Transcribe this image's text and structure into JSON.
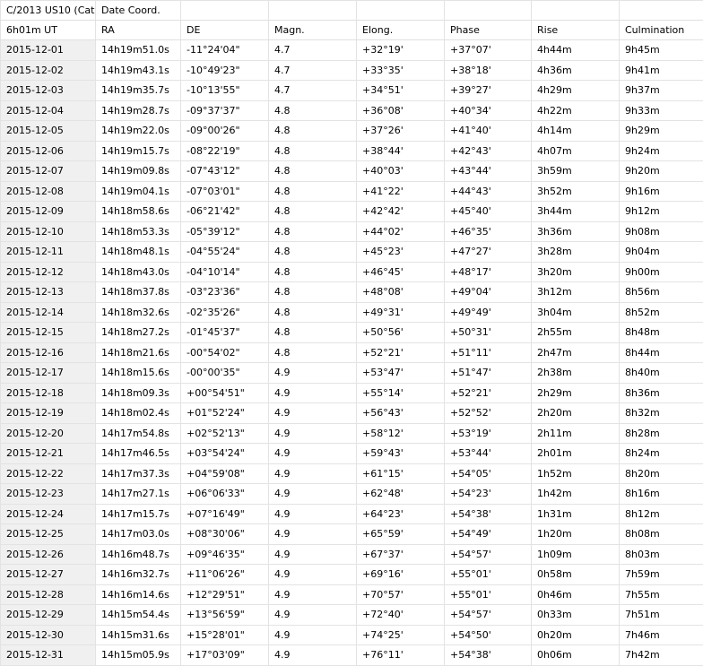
{
  "title_row": [
    "C/2013 US10 (Cata",
    "Date Coord.",
    "",
    "",
    "",
    "",
    "",
    ""
  ],
  "columns": [
    "6h01m UT",
    "RA",
    "DE",
    "Magn.",
    "Elong.",
    "Phase",
    "Rise",
    "Culmination"
  ],
  "rows": [
    [
      "2015-12-01",
      "14h19m51.0s",
      "-11°24'04\"",
      "4.7",
      "+32°19'",
      "+37°07'",
      "4h44m",
      "9h45m"
    ],
    [
      "2015-12-02",
      "14h19m43.1s",
      "-10°49'23\"",
      "4.7",
      "+33°35'",
      "+38°18'",
      "4h36m",
      "9h41m"
    ],
    [
      "2015-12-03",
      "14h19m35.7s",
      "-10°13'55\"",
      "4.7",
      "+34°51'",
      "+39°27'",
      "4h29m",
      "9h37m"
    ],
    [
      "2015-12-04",
      "14h19m28.7s",
      "-09°37'37\"",
      "4.8",
      "+36°08'",
      "+40°34'",
      "4h22m",
      "9h33m"
    ],
    [
      "2015-12-05",
      "14h19m22.0s",
      "-09°00'26\"",
      "4.8",
      "+37°26'",
      "+41°40'",
      "4h14m",
      "9h29m"
    ],
    [
      "2015-12-06",
      "14h19m15.7s",
      "-08°22'19\"",
      "4.8",
      "+38°44'",
      "+42°43'",
      "4h07m",
      "9h24m"
    ],
    [
      "2015-12-07",
      "14h19m09.8s",
      "-07°43'12\"",
      "4.8",
      "+40°03'",
      "+43°44'",
      "3h59m",
      "9h20m"
    ],
    [
      "2015-12-08",
      "14h19m04.1s",
      "-07°03'01\"",
      "4.8",
      "+41°22'",
      "+44°43'",
      "3h52m",
      "9h16m"
    ],
    [
      "2015-12-09",
      "14h18m58.6s",
      "-06°21'42\"",
      "4.8",
      "+42°42'",
      "+45°40'",
      "3h44m",
      "9h12m"
    ],
    [
      "2015-12-10",
      "14h18m53.3s",
      "-05°39'12\"",
      "4.8",
      "+44°02'",
      "+46°35'",
      "3h36m",
      "9h08m"
    ],
    [
      "2015-12-11",
      "14h18m48.1s",
      "-04°55'24\"",
      "4.8",
      "+45°23'",
      "+47°27'",
      "3h28m",
      "9h04m"
    ],
    [
      "2015-12-12",
      "14h18m43.0s",
      "-04°10'14\"",
      "4.8",
      "+46°45'",
      "+48°17'",
      "3h20m",
      "9h00m"
    ],
    [
      "2015-12-13",
      "14h18m37.8s",
      "-03°23'36\"",
      "4.8",
      "+48°08'",
      "+49°04'",
      "3h12m",
      "8h56m"
    ],
    [
      "2015-12-14",
      "14h18m32.6s",
      "-02°35'26\"",
      "4.8",
      "+49°31'",
      "+49°49'",
      "3h04m",
      "8h52m"
    ],
    [
      "2015-12-15",
      "14h18m27.2s",
      "-01°45'37\"",
      "4.8",
      "+50°56'",
      "+50°31'",
      "2h55m",
      "8h48m"
    ],
    [
      "2015-12-16",
      "14h18m21.6s",
      "-00°54'02\"",
      "4.8",
      "+52°21'",
      "+51°11'",
      "2h47m",
      "8h44m"
    ],
    [
      "2015-12-17",
      "14h18m15.6s",
      "-00°00'35\"",
      "4.9",
      "+53°47'",
      "+51°47'",
      "2h38m",
      "8h40m"
    ],
    [
      "2015-12-18",
      "14h18m09.3s",
      "+00°54'51\"",
      "4.9",
      "+55°14'",
      "+52°21'",
      "2h29m",
      "8h36m"
    ],
    [
      "2015-12-19",
      "14h18m02.4s",
      "+01°52'24\"",
      "4.9",
      "+56°43'",
      "+52°52'",
      "2h20m",
      "8h32m"
    ],
    [
      "2015-12-20",
      "14h17m54.8s",
      "+02°52'13\"",
      "4.9",
      "+58°12'",
      "+53°19'",
      "2h11m",
      "8h28m"
    ],
    [
      "2015-12-21",
      "14h17m46.5s",
      "+03°54'24\"",
      "4.9",
      "+59°43'",
      "+53°44'",
      "2h01m",
      "8h24m"
    ],
    [
      "2015-12-22",
      "14h17m37.3s",
      "+04°59'08\"",
      "4.9",
      "+61°15'",
      "+54°05'",
      "1h52m",
      "8h20m"
    ],
    [
      "2015-12-23",
      "14h17m27.1s",
      "+06°06'33\"",
      "4.9",
      "+62°48'",
      "+54°23'",
      "1h42m",
      "8h16m"
    ],
    [
      "2015-12-24",
      "14h17m15.7s",
      "+07°16'49\"",
      "4.9",
      "+64°23'",
      "+54°38'",
      "1h31m",
      "8h12m"
    ],
    [
      "2015-12-25",
      "14h17m03.0s",
      "+08°30'06\"",
      "4.9",
      "+65°59'",
      "+54°49'",
      "1h20m",
      "8h08m"
    ],
    [
      "2015-12-26",
      "14h16m48.7s",
      "+09°46'35\"",
      "4.9",
      "+67°37'",
      "+54°57'",
      "1h09m",
      "8h03m"
    ],
    [
      "2015-12-27",
      "14h16m32.7s",
      "+11°06'26\"",
      "4.9",
      "+69°16'",
      "+55°01'",
      "0h58m",
      "7h59m"
    ],
    [
      "2015-12-28",
      "14h16m14.6s",
      "+12°29'51\"",
      "4.9",
      "+70°57'",
      "+55°01'",
      "0h46m",
      "7h55m"
    ],
    [
      "2015-12-29",
      "14h15m54.4s",
      "+13°56'59\"",
      "4.9",
      "+72°40'",
      "+54°57'",
      "0h33m",
      "7h51m"
    ],
    [
      "2015-12-30",
      "14h15m31.6s",
      "+15°28'01\"",
      "4.9",
      "+74°25'",
      "+54°50'",
      "0h20m",
      "7h46m"
    ],
    [
      "2015-12-31",
      "14h15m05.9s",
      "+17°03'09\"",
      "4.9",
      "+76°11'",
      "+54°38'",
      "0h06m",
      "7h42m"
    ]
  ]
}
